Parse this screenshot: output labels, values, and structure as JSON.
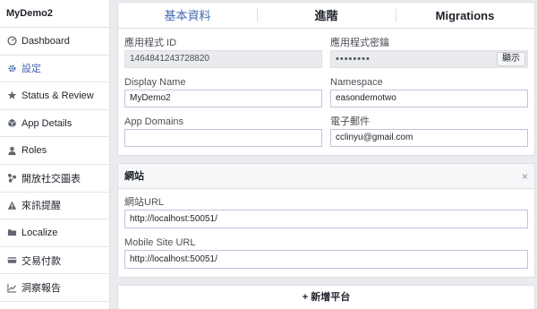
{
  "sidebar": {
    "app_name": "MyDemo2",
    "items": [
      {
        "label": "Dashboard",
        "icon": "dashboard-icon"
      },
      {
        "label": "設定",
        "icon": "gear-icon",
        "active": true
      },
      {
        "label": "Status & Review",
        "icon": "star-icon"
      },
      {
        "label": "App Details",
        "icon": "cube-icon"
      },
      {
        "label": "Roles",
        "icon": "person-icon"
      },
      {
        "label": "開放社交圖表",
        "icon": "graph-icon"
      },
      {
        "label": "來訊提醒",
        "icon": "alert-icon"
      },
      {
        "label": "Localize",
        "icon": "folder-icon"
      },
      {
        "label": "交易付款",
        "icon": "payment-icon"
      },
      {
        "label": "洞察報告",
        "icon": "chart-icon"
      }
    ]
  },
  "tabs": [
    {
      "label": "基本資料",
      "active": true
    },
    {
      "label": "進階"
    },
    {
      "label": "Migrations"
    }
  ],
  "basic": {
    "app_id_label": "應用程式 ID",
    "app_id_value": "1464841243728820",
    "app_secret_label": "應用程式密鑰",
    "app_secret_value": "••••••••",
    "show_button": "顯示",
    "display_name_label": "Display Name",
    "display_name_value": "MyDemo2",
    "namespace_label": "Namespace",
    "namespace_value": "easondemotwo",
    "app_domains_label": "App Domains",
    "app_domains_value": "",
    "email_label": "電子郵件",
    "email_value": "cclinyu@gmail.com"
  },
  "website": {
    "header": "網站",
    "close": "×",
    "site_url_label": "網站URL",
    "site_url_value": "http://localhost:50051/",
    "mobile_url_label": "Mobile Site URL",
    "mobile_url_value": "http://localhost:50051/"
  },
  "add_platform": "+ 新增平台",
  "colors": {
    "accent": "#4267b2",
    "background": "#e9ebee"
  }
}
